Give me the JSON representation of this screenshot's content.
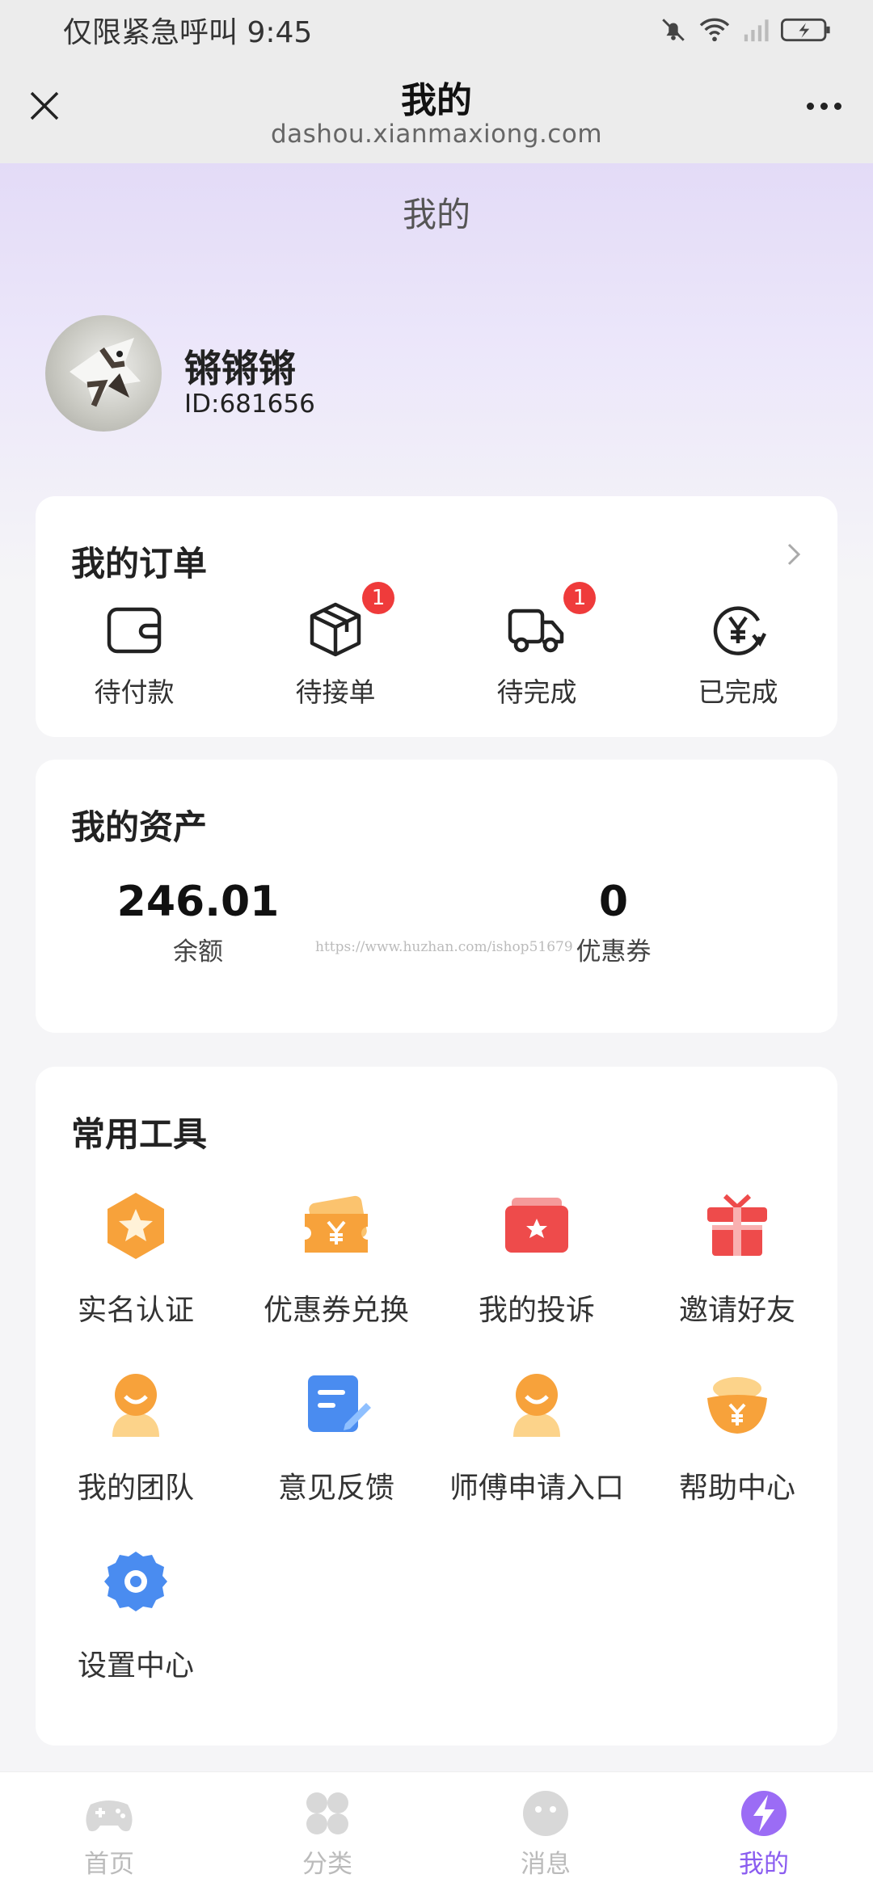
{
  "status_bar": {
    "carrier_text": "仅限紧急呼叫 9:45"
  },
  "webview": {
    "title": "我的",
    "url": "dashou.xianmaxiong.com"
  },
  "page": {
    "title": "我的"
  },
  "profile": {
    "username": "锵锵锵",
    "user_id": "ID:681656"
  },
  "orders": {
    "title": "我的订单",
    "items": [
      {
        "label": "待付款",
        "icon": "wallet-icon",
        "badge": null
      },
      {
        "label": "待接单",
        "icon": "package-icon",
        "badge": "1"
      },
      {
        "label": "待完成",
        "icon": "delivery-truck-icon",
        "badge": "1"
      },
      {
        "label": "已完成",
        "icon": "yen-refresh-icon",
        "badge": null
      }
    ]
  },
  "assets": {
    "title": "我的资产",
    "balance_value": "246.01",
    "balance_label": "余额",
    "coupon_value": "0",
    "coupon_label": "优惠券",
    "watermark": "https://www.huzhan.com/ishop51679"
  },
  "tools": {
    "title": "常用工具",
    "items": [
      {
        "label": "实名认证",
        "icon": "star-badge-icon"
      },
      {
        "label": "优惠券兑换",
        "icon": "coupon-ticket-icon"
      },
      {
        "label": "我的投诉",
        "icon": "complaint-card-icon"
      },
      {
        "label": "邀请好友",
        "icon": "gift-box-icon"
      },
      {
        "label": "我的团队",
        "icon": "team-smile-icon"
      },
      {
        "label": "意见反馈",
        "icon": "feedback-edit-icon"
      },
      {
        "label": "师傅申请入口",
        "icon": "master-smile-icon"
      },
      {
        "label": "帮助中心",
        "icon": "gold-ingot-icon"
      },
      {
        "label": "设置中心",
        "icon": "gear-icon"
      }
    ]
  },
  "tabbar": {
    "items": [
      {
        "label": "首页",
        "icon": "gamepad-icon",
        "active": false
      },
      {
        "label": "分类",
        "icon": "grid-icon",
        "active": false
      },
      {
        "label": "消息",
        "icon": "message-face-icon",
        "active": false
      },
      {
        "label": "我的",
        "icon": "lightning-icon",
        "active": true
      }
    ]
  },
  "colors": {
    "accent": "#8a5cf0",
    "badge": "#ef3b3b",
    "orange": "#f7a23b",
    "red": "#ee4b4b",
    "blue": "#4a8cf0"
  }
}
